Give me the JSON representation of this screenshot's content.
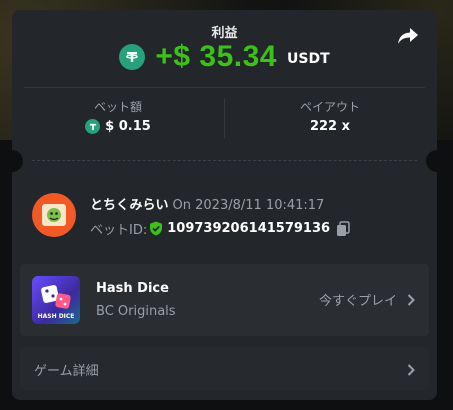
{
  "profit": {
    "label": "利益",
    "value": "+$ 35.34",
    "currency": "USDT"
  },
  "stats": {
    "bet_label": "ベット額",
    "bet_value": "$ 0.15",
    "payout_label": "ペイアウト",
    "payout_value": "222 x"
  },
  "user": {
    "name": "とちくみらい",
    "time": "On 2023/8/11 10:41:17",
    "bet_id_label": "ベットID:",
    "bet_id": "109739206141579136"
  },
  "game": {
    "name": "Hash Dice",
    "provider": "BC Originals",
    "thumb_label": "HASH DICE",
    "play_label": "今すぐプレイ"
  },
  "details": {
    "label": "ゲーム詳細"
  },
  "colors": {
    "profit_green": "#3bc117",
    "tether_green": "#26a17b",
    "card_bg": "#23262a"
  },
  "icons": [
    "share-icon",
    "tether-icon",
    "shield-check-icon",
    "copy-icon",
    "chevron-right-icon"
  ]
}
